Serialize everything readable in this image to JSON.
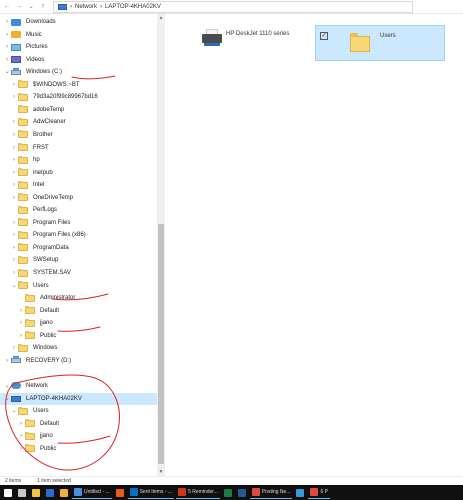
{
  "address_bar": {
    "back_icon": "arrow-left-icon",
    "forward_icon": "arrow-right-icon",
    "recent_icon": "chevron-down-icon",
    "up_icon": "arrow-up-icon",
    "crumbs": [
      "Network",
      "LAPTOP-4KHA02KV"
    ],
    "separator": "›"
  },
  "tree": [
    {
      "label": "Downloads",
      "icon": "downloads-icon",
      "chevron": "›",
      "indent": 0
    },
    {
      "label": "Music",
      "icon": "music-icon",
      "chevron": "›",
      "indent": 0
    },
    {
      "label": "Pictures",
      "icon": "pictures-icon",
      "chevron": "›",
      "indent": 0
    },
    {
      "label": "Videos",
      "icon": "videos-icon",
      "chevron": "›",
      "indent": 0
    },
    {
      "label": "Windows (C:)",
      "icon": "drive-icon",
      "chevron": "⌄",
      "indent": 0
    },
    {
      "label": "$WINDOWS.~BT",
      "icon": "folder-icon",
      "chevron": "›",
      "indent": 1
    },
    {
      "label": "79d3a20f99c89967bd16",
      "icon": "folder-icon",
      "chevron": "›",
      "indent": 1
    },
    {
      "label": "adobeTemp",
      "icon": "folder-icon",
      "chevron": "",
      "indent": 1
    },
    {
      "label": "AdwCleaner",
      "icon": "folder-icon",
      "chevron": "›",
      "indent": 1
    },
    {
      "label": "Brother",
      "icon": "folder-icon",
      "chevron": "›",
      "indent": 1
    },
    {
      "label": "FRST",
      "icon": "folder-icon",
      "chevron": "›",
      "indent": 1
    },
    {
      "label": "hp",
      "icon": "folder-icon",
      "chevron": "›",
      "indent": 1
    },
    {
      "label": "inetpub",
      "icon": "folder-icon",
      "chevron": "›",
      "indent": 1
    },
    {
      "label": "Intel",
      "icon": "folder-icon",
      "chevron": "›",
      "indent": 1
    },
    {
      "label": "OneDriveTemp",
      "icon": "folder-icon",
      "chevron": "›",
      "indent": 1
    },
    {
      "label": "PerfLogs",
      "icon": "folder-icon",
      "chevron": "",
      "indent": 1
    },
    {
      "label": "Program Files",
      "icon": "folder-icon",
      "chevron": "›",
      "indent": 1
    },
    {
      "label": "Program Files (x86)",
      "icon": "folder-icon",
      "chevron": "›",
      "indent": 1
    },
    {
      "label": "ProgramData",
      "icon": "folder-icon",
      "chevron": "›",
      "indent": 1
    },
    {
      "label": "SWSetup",
      "icon": "folder-icon",
      "chevron": "›",
      "indent": 1
    },
    {
      "label": "SYSTEM.SAV",
      "icon": "folder-icon",
      "chevron": "›",
      "indent": 1
    },
    {
      "label": "Users",
      "icon": "folder-icon",
      "chevron": "⌄",
      "indent": 1
    },
    {
      "label": "Administrator",
      "icon": "folder-icon",
      "chevron": "",
      "indent": 2
    },
    {
      "label": "Default",
      "icon": "folder-icon",
      "chevron": "›",
      "indent": 2
    },
    {
      "label": "jjano",
      "icon": "folder-icon",
      "chevron": "›",
      "indent": 2
    },
    {
      "label": "Public",
      "icon": "folder-icon",
      "chevron": "›",
      "indent": 2
    },
    {
      "label": "Windows",
      "icon": "folder-icon",
      "chevron": "›",
      "indent": 1
    },
    {
      "label": "RECOVERY (D:)",
      "icon": "drive-icon",
      "chevron": "›",
      "indent": 0
    },
    {
      "label": "",
      "icon": "",
      "chevron": "",
      "indent": 0
    },
    {
      "label": "Network",
      "icon": "network-icon",
      "chevron": "⌄",
      "indent": 0
    },
    {
      "label": "LAPTOP-4KHA02KV",
      "icon": "computer-icon",
      "chevron": "⌄",
      "indent": 0,
      "selected": true
    },
    {
      "label": "Users",
      "icon": "folder-icon",
      "chevron": "⌄",
      "indent": 1
    },
    {
      "label": "Default",
      "icon": "folder-icon",
      "chevron": "›",
      "indent": 2
    },
    {
      "label": "jjano",
      "icon": "folder-icon",
      "chevron": "›",
      "indent": 2
    },
    {
      "label": "Public",
      "icon": "folder-icon",
      "chevron": "›",
      "indent": 2
    }
  ],
  "content": {
    "items": [
      {
        "label": "HP DeskJet 1110 series",
        "icon": "printer-icon"
      },
      {
        "label": "Users",
        "icon": "folder-icon",
        "checked": "✓"
      }
    ]
  },
  "status_bar": {
    "count": "2 items",
    "selected": "1 item selected"
  },
  "taskbar": {
    "items": [
      {
        "label": "",
        "color": "#ffffff",
        "icon": "windows-start-icon"
      },
      {
        "label": "",
        "color": "#c8c8c8",
        "icon": "task-view-icon"
      },
      {
        "label": "",
        "color": "#f4c542",
        "icon": "file-explorer-icon"
      },
      {
        "label": "",
        "color": "#2b6ccf",
        "icon": "edge-icon"
      },
      {
        "label": "",
        "color": "#f0b030",
        "icon": "folder-icon"
      },
      {
        "label": "Untitled - ...",
        "color": "#4a8fe0",
        "icon": "notepad-icon"
      },
      {
        "label": "",
        "color": "#e85c1a",
        "icon": "app-icon"
      },
      {
        "label": "Sent Items - ...",
        "color": "#0072c6",
        "icon": "outlook-icon"
      },
      {
        "label": "5 Reminder...",
        "color": "#c93a1a",
        "icon": "reminder-icon"
      },
      {
        "label": "",
        "color": "#1d7b45",
        "icon": "excel-icon"
      },
      {
        "label": "",
        "color": "#2b5797",
        "icon": "word-icon"
      },
      {
        "label": "Posting Ne...",
        "color": "#dd4b39",
        "icon": "chrome-icon"
      },
      {
        "label": "",
        "color": "#3a9ad9",
        "icon": "app-icon"
      },
      {
        "label": "6 P",
        "color": "#dd4b39",
        "icon": "chrome-icon"
      }
    ]
  },
  "colors": {
    "selected_bg": "#cce8ff",
    "folder": "#f8d775",
    "annotation": "#e02020",
    "taskbar": "#101010"
  }
}
